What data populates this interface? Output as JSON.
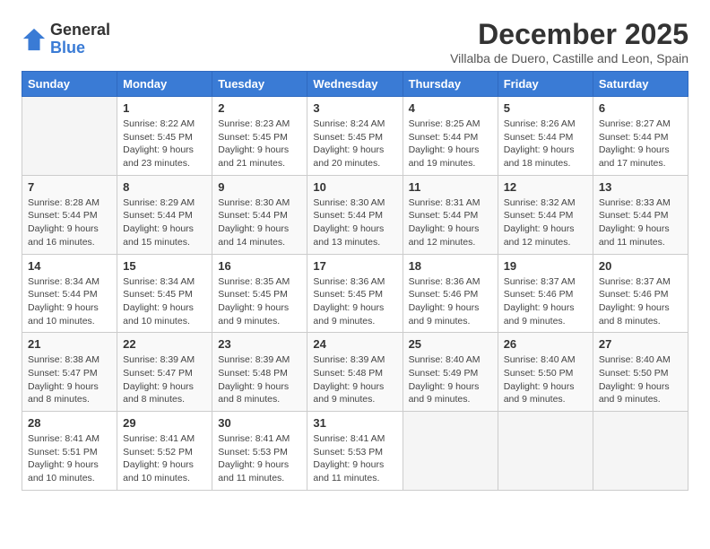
{
  "logo": {
    "general": "General",
    "blue": "Blue"
  },
  "title": "December 2025",
  "location": "Villalba de Duero, Castille and Leon, Spain",
  "headers": [
    "Sunday",
    "Monday",
    "Tuesday",
    "Wednesday",
    "Thursday",
    "Friday",
    "Saturday"
  ],
  "weeks": [
    [
      {
        "day": "",
        "info": ""
      },
      {
        "day": "1",
        "info": "Sunrise: 8:22 AM\nSunset: 5:45 PM\nDaylight: 9 hours\nand 23 minutes."
      },
      {
        "day": "2",
        "info": "Sunrise: 8:23 AM\nSunset: 5:45 PM\nDaylight: 9 hours\nand 21 minutes."
      },
      {
        "day": "3",
        "info": "Sunrise: 8:24 AM\nSunset: 5:45 PM\nDaylight: 9 hours\nand 20 minutes."
      },
      {
        "day": "4",
        "info": "Sunrise: 8:25 AM\nSunset: 5:44 PM\nDaylight: 9 hours\nand 19 minutes."
      },
      {
        "day": "5",
        "info": "Sunrise: 8:26 AM\nSunset: 5:44 PM\nDaylight: 9 hours\nand 18 minutes."
      },
      {
        "day": "6",
        "info": "Sunrise: 8:27 AM\nSunset: 5:44 PM\nDaylight: 9 hours\nand 17 minutes."
      }
    ],
    [
      {
        "day": "7",
        "info": "Sunrise: 8:28 AM\nSunset: 5:44 PM\nDaylight: 9 hours\nand 16 minutes."
      },
      {
        "day": "8",
        "info": "Sunrise: 8:29 AM\nSunset: 5:44 PM\nDaylight: 9 hours\nand 15 minutes."
      },
      {
        "day": "9",
        "info": "Sunrise: 8:30 AM\nSunset: 5:44 PM\nDaylight: 9 hours\nand 14 minutes."
      },
      {
        "day": "10",
        "info": "Sunrise: 8:30 AM\nSunset: 5:44 PM\nDaylight: 9 hours\nand 13 minutes."
      },
      {
        "day": "11",
        "info": "Sunrise: 8:31 AM\nSunset: 5:44 PM\nDaylight: 9 hours\nand 12 minutes."
      },
      {
        "day": "12",
        "info": "Sunrise: 8:32 AM\nSunset: 5:44 PM\nDaylight: 9 hours\nand 12 minutes."
      },
      {
        "day": "13",
        "info": "Sunrise: 8:33 AM\nSunset: 5:44 PM\nDaylight: 9 hours\nand 11 minutes."
      }
    ],
    [
      {
        "day": "14",
        "info": "Sunrise: 8:34 AM\nSunset: 5:44 PM\nDaylight: 9 hours\nand 10 minutes."
      },
      {
        "day": "15",
        "info": "Sunrise: 8:34 AM\nSunset: 5:45 PM\nDaylight: 9 hours\nand 10 minutes."
      },
      {
        "day": "16",
        "info": "Sunrise: 8:35 AM\nSunset: 5:45 PM\nDaylight: 9 hours\nand 9 minutes."
      },
      {
        "day": "17",
        "info": "Sunrise: 8:36 AM\nSunset: 5:45 PM\nDaylight: 9 hours\nand 9 minutes."
      },
      {
        "day": "18",
        "info": "Sunrise: 8:36 AM\nSunset: 5:46 PM\nDaylight: 9 hours\nand 9 minutes."
      },
      {
        "day": "19",
        "info": "Sunrise: 8:37 AM\nSunset: 5:46 PM\nDaylight: 9 hours\nand 9 minutes."
      },
      {
        "day": "20",
        "info": "Sunrise: 8:37 AM\nSunset: 5:46 PM\nDaylight: 9 hours\nand 8 minutes."
      }
    ],
    [
      {
        "day": "21",
        "info": "Sunrise: 8:38 AM\nSunset: 5:47 PM\nDaylight: 9 hours\nand 8 minutes."
      },
      {
        "day": "22",
        "info": "Sunrise: 8:39 AM\nSunset: 5:47 PM\nDaylight: 9 hours\nand 8 minutes."
      },
      {
        "day": "23",
        "info": "Sunrise: 8:39 AM\nSunset: 5:48 PM\nDaylight: 9 hours\nand 8 minutes."
      },
      {
        "day": "24",
        "info": "Sunrise: 8:39 AM\nSunset: 5:48 PM\nDaylight: 9 hours\nand 9 minutes."
      },
      {
        "day": "25",
        "info": "Sunrise: 8:40 AM\nSunset: 5:49 PM\nDaylight: 9 hours\nand 9 minutes."
      },
      {
        "day": "26",
        "info": "Sunrise: 8:40 AM\nSunset: 5:50 PM\nDaylight: 9 hours\nand 9 minutes."
      },
      {
        "day": "27",
        "info": "Sunrise: 8:40 AM\nSunset: 5:50 PM\nDaylight: 9 hours\nand 9 minutes."
      }
    ],
    [
      {
        "day": "28",
        "info": "Sunrise: 8:41 AM\nSunset: 5:51 PM\nDaylight: 9 hours\nand 10 minutes."
      },
      {
        "day": "29",
        "info": "Sunrise: 8:41 AM\nSunset: 5:52 PM\nDaylight: 9 hours\nand 10 minutes."
      },
      {
        "day": "30",
        "info": "Sunrise: 8:41 AM\nSunset: 5:53 PM\nDaylight: 9 hours\nand 11 minutes."
      },
      {
        "day": "31",
        "info": "Sunrise: 8:41 AM\nSunset: 5:53 PM\nDaylight: 9 hours\nand 11 minutes."
      },
      {
        "day": "",
        "info": ""
      },
      {
        "day": "",
        "info": ""
      },
      {
        "day": "",
        "info": ""
      }
    ]
  ]
}
